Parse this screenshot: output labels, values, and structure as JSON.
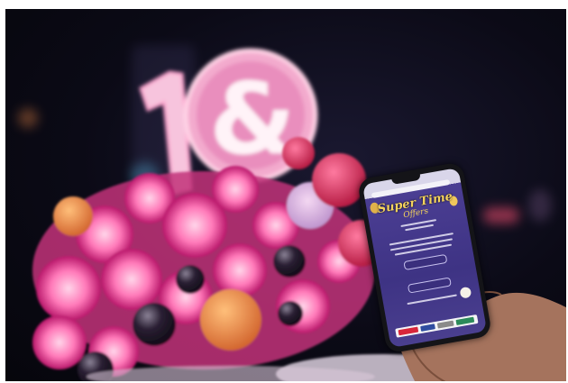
{
  "scene": {
    "description_free": true
  },
  "phone_screen": {
    "promo_title": "Super Time",
    "promo_subtitle": "Offers"
  },
  "colors": {
    "background_night": "#0b0a16",
    "sign_pink": "#f2b5d4",
    "promo_purple": "#3e3384",
    "promo_gold": "#f4d35c"
  },
  "icons": [
    "illuminated-sign-icon",
    "smartphone-icon",
    "hand-icon",
    "balloon-icon"
  ]
}
